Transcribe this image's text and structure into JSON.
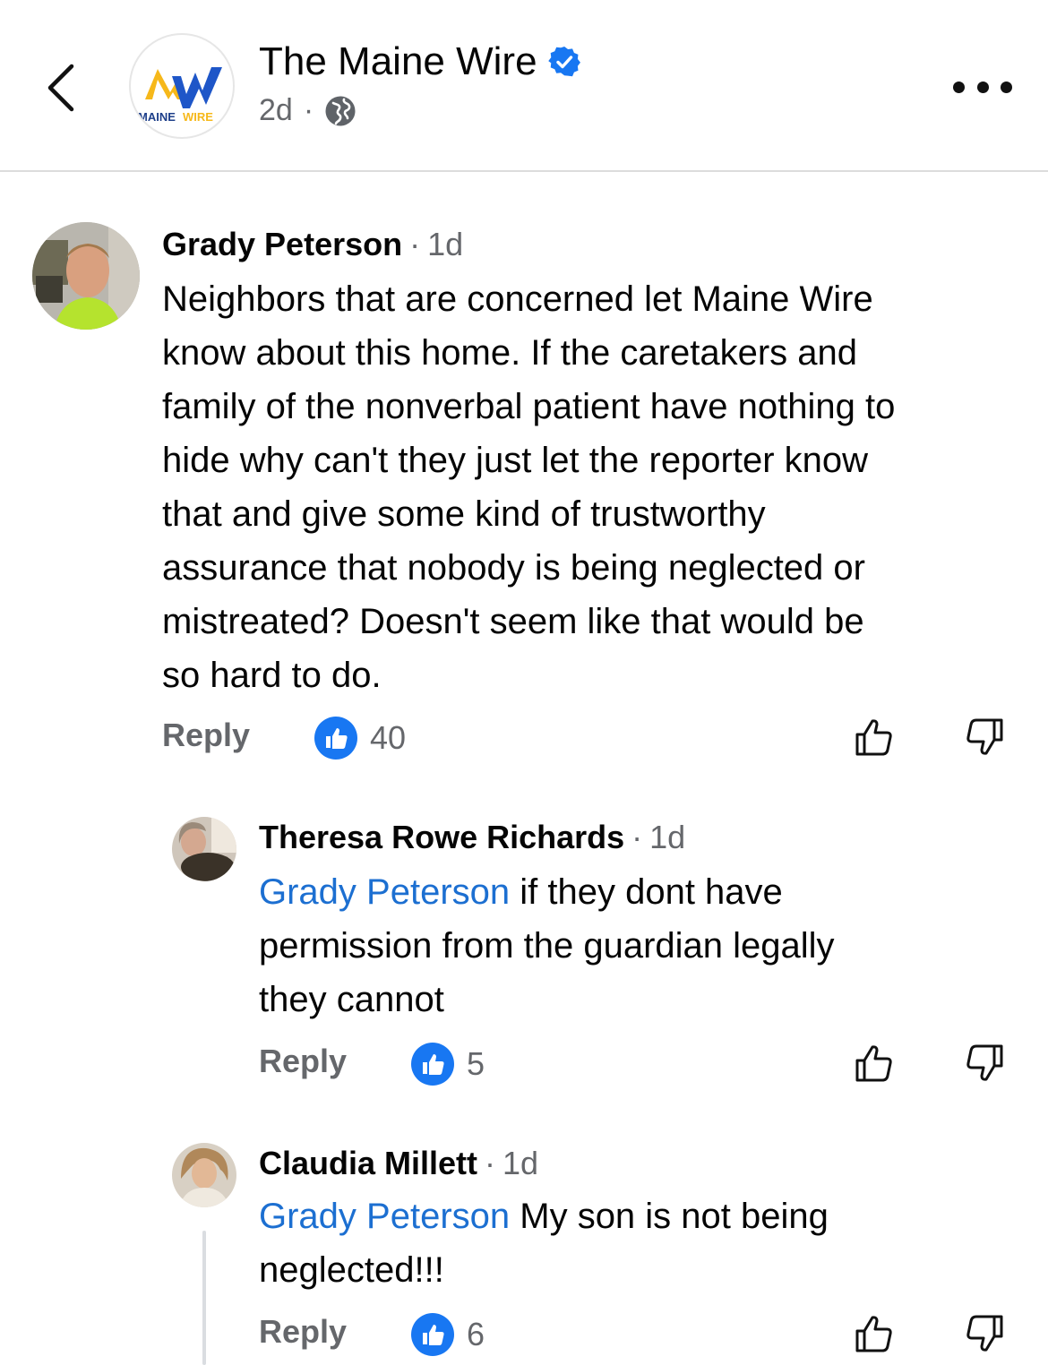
{
  "header": {
    "page_name": "The Maine Wire",
    "post_age": "2d",
    "meta_separator": "·",
    "logo_text_left": "MAINE",
    "logo_text_right": "WIRE",
    "verified_color": "#1877f2",
    "icons": {
      "back": "chevron-left-icon",
      "verified": "verified-badge-icon",
      "privacy": "globe-icon",
      "more": "more-dots-icon"
    }
  },
  "comments": [
    {
      "author": "Grady Peterson",
      "separator": "·",
      "age": "1d",
      "text": "Neighbors that are concerned let Maine Wire\nknow about this home. If the caretakers and\nfamily of the nonverbal patient have nothing to\nhide why can't they just let the reporter know\nthat and give some kind of trustworthy\nassurance that nobody is being neglected or\nmistreated? Doesn't seem like that would be\nso hard to do.",
      "reply_label": "Reply",
      "likes": "40"
    },
    {
      "author": "Theresa Rowe Richards",
      "separator": "·",
      "age": "1d",
      "mention": "Grady Peterson",
      "text": " if they dont have\npermission from the guardian legally\nthey cannot",
      "reply_label": "Reply",
      "likes": "5"
    },
    {
      "author": "Claudia Millett",
      "separator": "·",
      "age": "1d",
      "mention": "Grady Peterson",
      "text": " My son is not being\nneglected!!!",
      "reply_label": "Reply",
      "likes": "6"
    }
  ],
  "colors": {
    "mention": "#1c6fd1",
    "like_badge": "#1877f2",
    "secondary_text": "#65676b"
  }
}
